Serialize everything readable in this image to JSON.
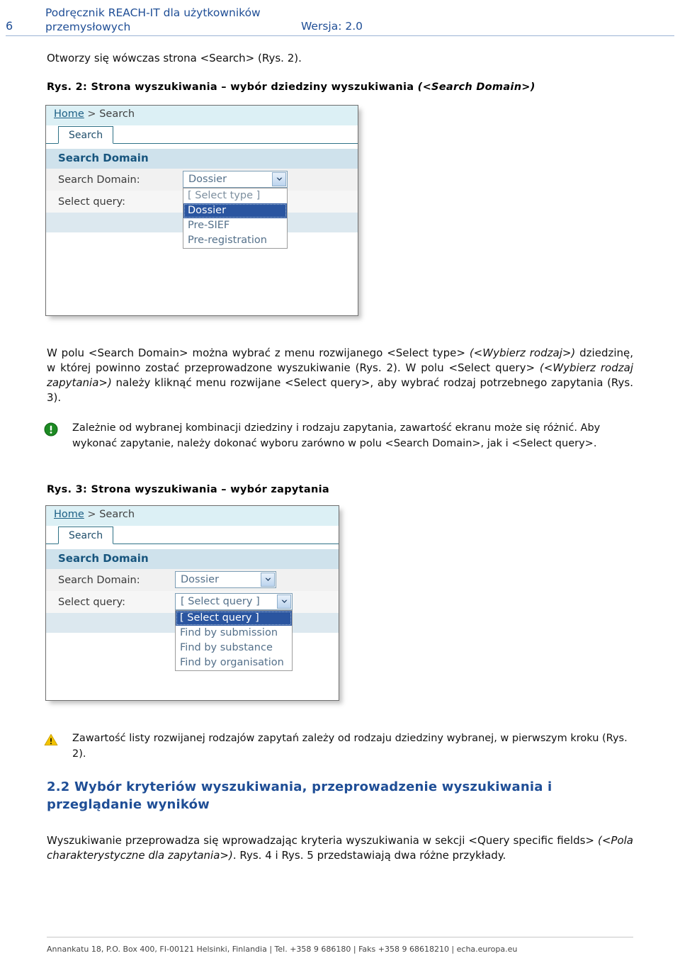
{
  "header": {
    "page_number": "6",
    "title": "Podręcznik REACH-IT dla użytkowników przemysłowych",
    "version": "Wersja: 2.0"
  },
  "content": {
    "intro_line": "Otworzy się wówczas strona <Search> (Rys. 2).",
    "fig2_caption_plain": "Rys. 2: Strona wyszukiwania – wybór dziedziny wyszukiwania ",
    "fig2_caption_italic": "(<Search Domain>)",
    "fig3_caption_plain": "Rys. 3: Strona wyszukiwania – wybór zapytania",
    "para1_seg1": "W polu <Search Domain> można wybrać z menu rozwijanego <Select type> ",
    "para1_italic1": "(<Wybierz rodzaj>)",
    "para1_seg2": " dziedzinę, w której powinno zostać przeprowadzone wyszukiwanie (Rys. 2). W polu <Select query> ",
    "para1_italic2": "(<Wybierz rodzaj zapytania>)",
    "para1_seg3": " należy kliknąć menu rozwijane <Select query>, aby wybrać rodzaj potrzebnego zapytania (Rys. 3).",
    "note_info": "Zależnie od wybranej kombinacji dziedziny i rodzaju zapytania, zawartość ekranu może się różnić. Aby wykonać zapytanie, należy dokonać wyboru zarówno w polu <Search Domain>, jak i <Select query>.",
    "note_warning": "Zawartość listy rozwijanej rodzajów zapytań zależy od rodzaju dziedziny wybranej, w pierwszym kroku (Rys. 2).",
    "section_heading": "2.2 Wybór kryteriów wyszukiwania, przeprowadzenie wyszukiwania i przeglądanie wyników",
    "para2_seg1": "Wyszukiwanie przeprowadza się wprowadzając kryteria wyszukiwania w sekcji <Query specific fields> ",
    "para2_italic1": "(<Pola charakterystyczne dla zapytania>)",
    "para2_seg2": ". Rys. 4 i Rys. 5 przedstawiają dwa różne przykłady."
  },
  "figure2": {
    "breadcrumb_home": "Home",
    "breadcrumb_sep": " > ",
    "breadcrumb_current": "Search",
    "tab_label": "Search",
    "panel_title": "Search Domain",
    "label_search_domain": "Search Domain:",
    "label_select_query": "Select query:",
    "select_domain_value": "Dossier",
    "dropdown_options": [
      "[ Select type ]",
      "Dossier",
      "Pre-SIEF",
      "Pre-registration"
    ],
    "dropdown_selected_index": 1
  },
  "figure3": {
    "breadcrumb_home": "Home",
    "breadcrumb_sep": " > ",
    "breadcrumb_current": "Search",
    "tab_label": "Search",
    "panel_title": "Search Domain",
    "label_search_domain": "Search Domain:",
    "label_select_query": "Select query:",
    "select_domain_value": "Dossier",
    "select_query_value": "[ Select query ]",
    "dropdown_options": [
      "[ Select query ]",
      "Find by submission",
      "Find by substance",
      "Find by organisation"
    ],
    "dropdown_selected_index": 0
  },
  "footer": {
    "text": "Annankatu 18, P.O. Box 400, FI-00121 Helsinki, Finlandia | Tel. +358 9 686180 | Faks +358 9 68618210 | echa.europa.eu"
  },
  "colors": {
    "header_blue": "#1F4E96",
    "breadcrumb_bg": "#DCF0F5",
    "panel_title_bg": "#CFE2EC",
    "dropdown_selected_bg": "#2A55A0",
    "note_info_icon": "#1D8A23",
    "note_warning_icon": "#F2C300"
  }
}
